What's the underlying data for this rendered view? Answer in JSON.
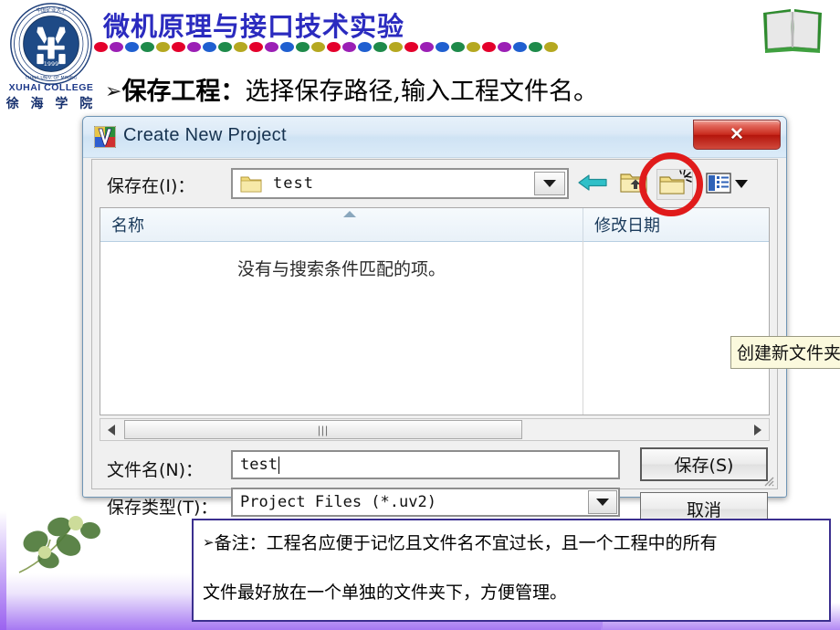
{
  "slide": {
    "header_title": "微机原理与接口技术实验",
    "logo": {
      "name": "xuhai-college-emblem",
      "english": "XUHAI  COLLEGE",
      "chinese": "徐 海 学 院",
      "year": "1999",
      "ring_text": "CHINA UNIVERSITY OF MINING & TECHNOLOGY"
    },
    "book_icon": "open-book-icon",
    "bullet": {
      "marker": "➢",
      "bold_part": "保存工程：",
      "rest_part": "选择保存路径,输入工程文件名。"
    },
    "dots_colors": [
      "#e4002b",
      "#9b1fb5",
      "#1f5fd0",
      "#1e8a4a",
      "#b5a820"
    ],
    "dots_count": 30,
    "accent_purple": "#a678f2",
    "title_color": "#2b2bbf"
  },
  "dialog": {
    "title": "Create New Project",
    "app_icon": "keil-uvision-icon",
    "close_label": "✕",
    "close_color": "#c8291c",
    "savein": {
      "label": "保存在(I)：",
      "value": "test",
      "folder_icon": "folder-icon",
      "dropdown_icon": "chevron-down-icon"
    },
    "toolbar": [
      {
        "name": "back-button",
        "icon": "back-arrow-icon",
        "tooltip": ""
      },
      {
        "name": "up-folder-button",
        "icon": "up-folder-icon",
        "tooltip": ""
      },
      {
        "name": "new-folder-button",
        "icon": "new-folder-icon",
        "tooltip": "创建新文件夹"
      },
      {
        "name": "views-button",
        "icon": "views-list-icon",
        "tooltip": ""
      }
    ],
    "tooltip_text": "创建新文件夹",
    "columns": [
      {
        "key": "name",
        "label": "名称",
        "sorted": "asc"
      },
      {
        "key": "modified",
        "label": "修改日期"
      }
    ],
    "empty_message": "没有与搜索条件匹配的项。",
    "scrollbar": {
      "left_icon": "caret-left-icon",
      "right_icon": "caret-right-icon",
      "grip": "|||"
    },
    "filename": {
      "label": "文件名(N)：",
      "value": "test"
    },
    "filetype": {
      "label": "保存类型(T)：",
      "value": "Project Files (*.uv2)"
    },
    "buttons": [
      {
        "name": "save-button",
        "label": "保存(S)",
        "default": true
      },
      {
        "name": "cancel-button",
        "label": "取消",
        "default": false
      }
    ],
    "annotation": {
      "shape": "circle",
      "color": "#e01b1b",
      "target": "new-folder-button"
    }
  },
  "note": {
    "marker": "➢",
    "line1": "备注：工程名应便于记忆且文件名不宜过长，且一个工程中的所有",
    "line2": "文件最好放在一个单独的文件夹下，方便管理。",
    "border_color": "#3b2f8f"
  }
}
